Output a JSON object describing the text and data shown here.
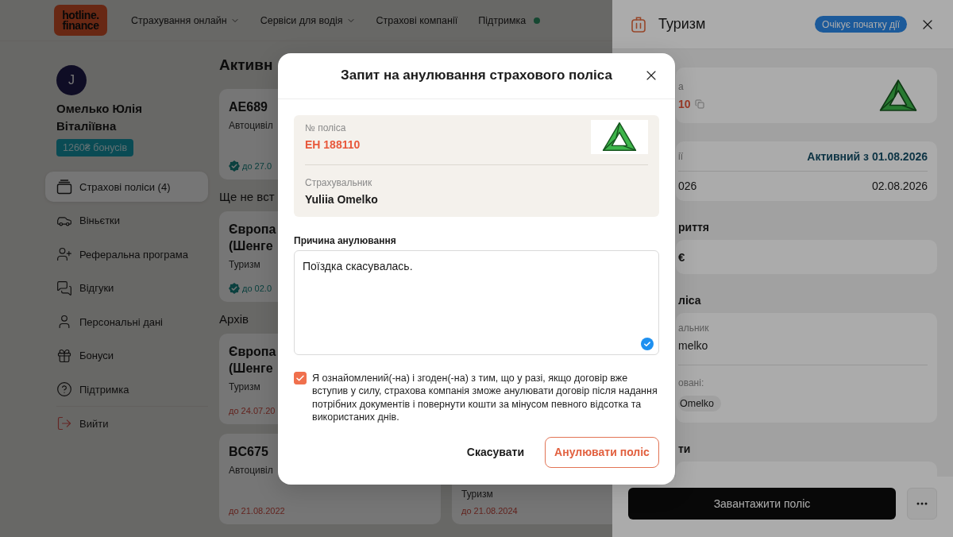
{
  "header": {
    "logo": {
      "lines": [
        "hotline.",
        "finance"
      ]
    },
    "nav": [
      {
        "label": "Страхування онлайн",
        "kind": "dropdown"
      },
      {
        "label": "Сервіси для водія",
        "kind": "dropdown"
      },
      {
        "label": "Страхові компанії",
        "kind": "link"
      },
      {
        "label": "Підтримка",
        "kind": "online"
      }
    ]
  },
  "profile": {
    "avatar_initial": "J",
    "name": "Омелько Юлія Віталіївна",
    "bonus_badge": "1260₴ бонусів"
  },
  "sidebar": {
    "items": [
      {
        "label": "Страхові поліси (4)",
        "selected": true,
        "kind": "link"
      },
      {
        "label": "Віньєтки",
        "selected": false,
        "kind": "link"
      },
      {
        "label": "Реферальна програма",
        "selected": false,
        "kind": "link"
      },
      {
        "label": "Відгуки",
        "selected": false,
        "kind": "link"
      },
      {
        "label": "Персональні дані",
        "selected": false,
        "kind": "link"
      },
      {
        "label": "Бонуси",
        "selected": false,
        "kind": "link"
      },
      {
        "label": "Підтримка",
        "selected": false,
        "kind": "link"
      },
      {
        "label": "Вийти",
        "selected": false,
        "kind": "logout"
      }
    ]
  },
  "policies": {
    "sections": [
      {
        "title": "Активн",
        "rows": [
          [
            {
              "title": "AE689",
              "type": "Автоцивіл",
              "validity": "до 27.0",
              "expired": false
            }
          ]
        ]
      },
      {
        "title": "Ще не вст",
        "rows": [
          [
            {
              "title": "Європа\n(Шенге",
              "type": "Туризм",
              "validity": "до 02.0",
              "expired": false
            }
          ]
        ]
      },
      {
        "title": "Архів",
        "rows": [
          [
            {
              "title": "Європа\n(Шенге",
              "type": "Туризм",
              "validity": "до 24.07.20",
              "expired": true
            }
          ],
          [
            {
              "title": "BC675",
              "type": "Автоцивіл",
              "validity": "до 21.08.2022",
              "expired": true
            },
            {
              "type": "Туризм",
              "validity": "до 21.08.2024",
              "expired": true
            }
          ]
        ]
      }
    ]
  },
  "drawer": {
    "title": "Туризм",
    "status_badge": "Очікує початку дії",
    "policy": {
      "label": "а",
      "number": "10"
    },
    "period": {
      "label": "ії",
      "status": "Активний з 01.08.2026",
      "start": "026",
      "end": "02.08.2026"
    },
    "coverage": {
      "heading": "риття",
      "amount": "€"
    },
    "participants": {
      "heading": "ліса",
      "holder_label": "альник",
      "holder": "melko",
      "insured_label": "овані:",
      "insured": [
        "Omelko"
      ]
    },
    "documents": {
      "heading": "ти"
    },
    "download_button": "Завантажити поліс"
  },
  "modal": {
    "title": "Запит на анулювання страхового поліса",
    "policy": {
      "number_label": "№ поліса",
      "number": "EH 188110",
      "holder_label": "Страхувальник",
      "holder": "Yuliia Omelko"
    },
    "reason": {
      "label": "Причина анулювання",
      "value": "Поїздка скасувалась."
    },
    "consent": {
      "checked": true,
      "text": "Я ознайомлений(-на) і згоден(-на) з тим, що у разі, якщо договір вже вступив у силу, страхова компанія зможе анулювати договір після надання потрібних документів і повернути кошти за мінусом певного відсотка та використаних днів."
    },
    "buttons": [
      {
        "label": "Скасувати",
        "kind": "plain"
      },
      {
        "label": "Анулювати поліс",
        "kind": "outline"
      }
    ]
  }
}
